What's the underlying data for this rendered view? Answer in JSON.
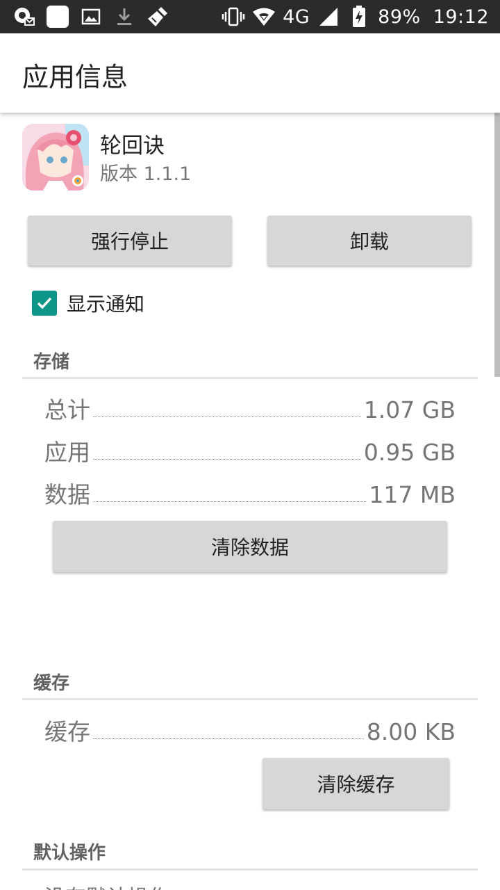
{
  "status_bar": {
    "network": "4G",
    "battery": "89%",
    "time": "19:12"
  },
  "appbar": {
    "title": "应用信息"
  },
  "app": {
    "name": "轮回诀",
    "version": "版本 1.1.1"
  },
  "buttons": {
    "force_stop": "强行停止",
    "uninstall": "卸载",
    "clear_data": "清除数据",
    "clear_cache": "清除缓存"
  },
  "notifications": {
    "label": "显示通知",
    "checked": true
  },
  "storage": {
    "header": "存储",
    "rows": [
      {
        "label": "总计",
        "value": "1.07 GB"
      },
      {
        "label": "应用",
        "value": "0.95 GB"
      },
      {
        "label": "数据",
        "value": "117 MB"
      }
    ]
  },
  "cache": {
    "header": "缓存",
    "rows": [
      {
        "label": "缓存",
        "value": "8.00 KB"
      }
    ]
  },
  "defaults": {
    "header": "默认操作",
    "text": "没有默认操作"
  },
  "colors": {
    "accent": "#0c9688",
    "status_bar": "#2b2b2b",
    "button": "#d6d7d7"
  }
}
